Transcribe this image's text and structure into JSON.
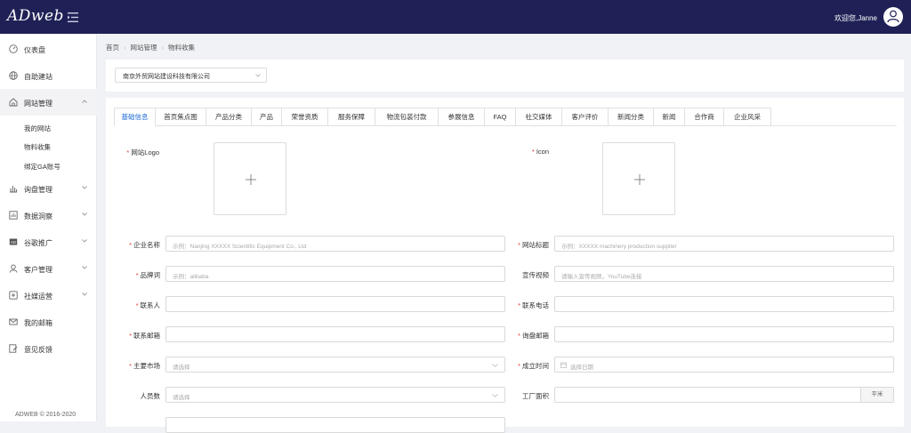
{
  "header": {
    "logo": "ADweb",
    "welcome": "欢迎您,Janne"
  },
  "sidebar": {
    "items": [
      {
        "label": "仪表盘",
        "icon": "dashboard-icon"
      },
      {
        "label": "自助建站",
        "icon": "globe-icon"
      },
      {
        "label": "网站管理",
        "icon": "website-icon",
        "expanded": true,
        "children": [
          "我的网站",
          "物料收集",
          "绑定GA账号"
        ]
      },
      {
        "label": "询盘管理",
        "icon": "bar-chart-icon"
      },
      {
        "label": "数据洞察",
        "icon": "data-insight-icon"
      },
      {
        "label": "谷歌推广",
        "icon": "ad-icon"
      },
      {
        "label": "客户管理",
        "icon": "user-icon"
      },
      {
        "label": "社媒运营",
        "icon": "social-icon"
      },
      {
        "label": "我的邮箱",
        "icon": "mail-icon"
      },
      {
        "label": "意见反馈",
        "icon": "feedback-icon"
      }
    ],
    "copyright": "ADWEB © 2016-2020"
  },
  "breadcrumb": [
    "首页",
    "网站管理",
    "物料收集"
  ],
  "company_select": {
    "value": "南京外贸网站建设科技有限公司"
  },
  "tabs": [
    "基础信息",
    "首页焦点图",
    "产品分类",
    "产品",
    "荣誉资质",
    "服务保障",
    "物流包装付款",
    "参展信息",
    "FAQ",
    "社交媒体",
    "客户评价",
    "新闻分类",
    "新闻",
    "合作商",
    "企业风采"
  ],
  "form": {
    "logo_label": "网站Logo",
    "icon_label": "Icon",
    "company_name_label": "企业名称",
    "company_name_placeholder": "示例：Nanjing XXXXX Scientific Equipment Co., Ltd",
    "site_title_label": "网站标题",
    "site_title_placeholder": "示例：XXXXX machinery production supplier",
    "brand_label": "品牌词",
    "brand_placeholder": "示例：alibaba",
    "video_label": "宣传视频",
    "video_placeholder": "请输入宣传视频，YouTube连接",
    "contact_label": "联系人",
    "phone_label": "联系电话",
    "email_label": "联系邮箱",
    "inquiry_email_label": "询盘邮箱",
    "market_label": "主要市场",
    "market_placeholder": "请选择",
    "founded_label": "成立时间",
    "founded_placeholder": "选择日期",
    "staff_label": "人员数",
    "staff_placeholder": "请选择",
    "factory_area_label": "工厂面积",
    "factory_area_unit": "平米"
  },
  "colors": {
    "topbar": "#1f2156",
    "active_tab": "#1e6bd6",
    "required": "#e23c3c"
  }
}
